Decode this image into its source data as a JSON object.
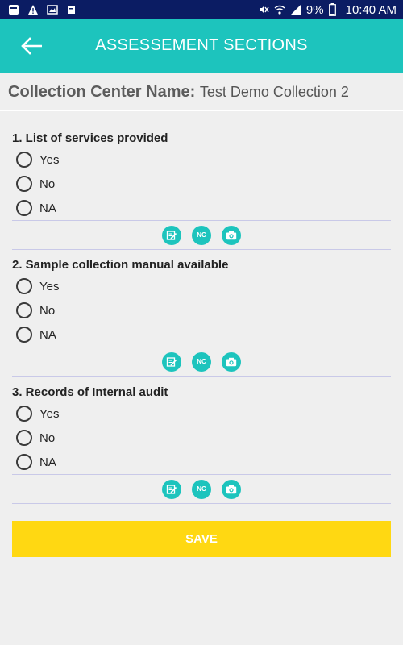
{
  "status_bar": {
    "battery": "9%",
    "time": "10:40 AM"
  },
  "app_bar": {
    "title": "ASSESSEMENT SECTIONS",
    "back_icon": "arrow-left-icon"
  },
  "center": {
    "label": "Collection Center Name:",
    "value": "Test Demo Collection 2"
  },
  "questions": [
    {
      "title": "1. List of services provided",
      "options": [
        "Yes",
        "No",
        "NA"
      ]
    },
    {
      "title": "2. Sample collection manual available",
      "options": [
        "Yes",
        "No",
        "NA"
      ]
    },
    {
      "title": "3. Records of Internal audit",
      "options": [
        "Yes",
        "No",
        "NA"
      ]
    }
  ],
  "actions": {
    "edit_icon": "edit-note-icon",
    "nc_label": "NC",
    "camera_icon": "camera-icon"
  },
  "save_label": "SAVE",
  "colors": {
    "status_bar": "#0b1c63",
    "app_bar": "#1dc4bd",
    "save": "#ffd812"
  }
}
